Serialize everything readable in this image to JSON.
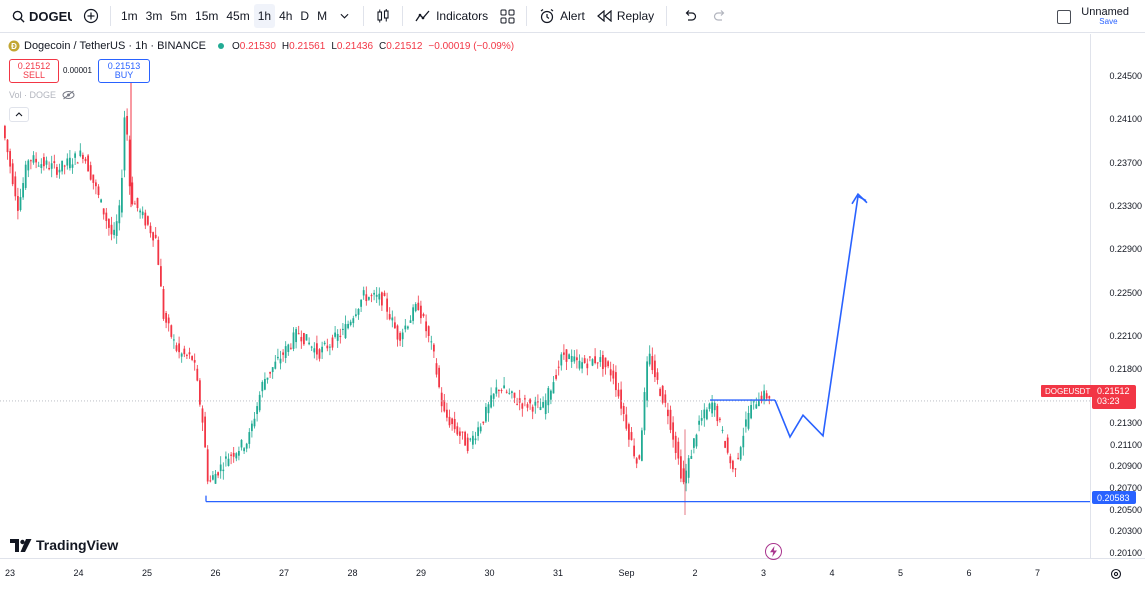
{
  "toolbar": {
    "symbol": "DOGEUSDT",
    "intervals": [
      "1m",
      "3m",
      "5m",
      "15m",
      "45m",
      "1h",
      "4h",
      "D",
      "M"
    ],
    "active_interval": "1h",
    "indicators_label": "Indicators",
    "alert_label": "Alert",
    "replay_label": "Replay",
    "layout_name": "Unnamed",
    "layout_save": "Save"
  },
  "legend": {
    "title": "Dogecoin / TetherUS · 1h · BINANCE",
    "ohlc": [
      {
        "k": "O",
        "v": "0.21530"
      },
      {
        "k": "H",
        "v": "0.21561"
      },
      {
        "k": "L",
        "v": "0.21436"
      },
      {
        "k": "C",
        "v": "0.21512"
      }
    ],
    "change": "−0.00019 (−0.09%)"
  },
  "trade": {
    "sell_price": "0.21512",
    "sell_label": "SELL",
    "spread": "0.00001",
    "buy_price": "0.21513",
    "buy_label": "BUY"
  },
  "volume_label": "Vol · DOGE",
  "price_ticks": [
    "0.24500",
    "0.24100",
    "0.23700",
    "0.23300",
    "0.22900",
    "0.22500",
    "0.22100",
    "0.21800",
    "0.21300",
    "0.21100",
    "0.20900",
    "0.20700",
    "0.20500",
    "0.20300",
    "0.20100"
  ],
  "current_price": {
    "symbol": "DOGEUSDT",
    "price": "0.21512",
    "countdown": "03:23"
  },
  "support_level": "0.20583",
  "time_ticks": [
    "23",
    "24",
    "25",
    "26",
    "27",
    "28",
    "29",
    "30",
    "31",
    "Sep",
    "2",
    "3",
    "4",
    "5",
    "6",
    "7"
  ],
  "brand": "TradingView",
  "colors": {
    "up": "#22ab94",
    "down": "#f23645",
    "drawing": "#2962ff",
    "accent": "#2962ff"
  }
}
